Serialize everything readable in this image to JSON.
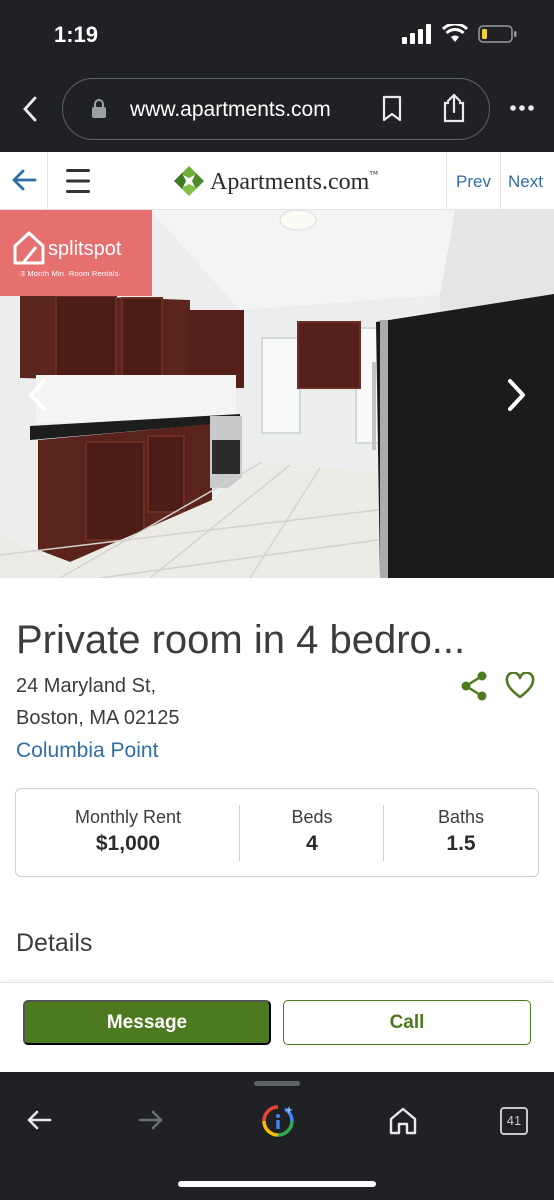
{
  "status_bar": {
    "time": "1:19"
  },
  "browser": {
    "url": "www.apartments.com",
    "tab_count": "41"
  },
  "site": {
    "logo": "Apartments.com",
    "logo_tm": "™",
    "prev": "Prev",
    "next": "Next"
  },
  "photo_badge": {
    "brand": "splitspot",
    "tagline": "·3 Month Min. Room Rentals·"
  },
  "listing": {
    "title": "Private room in 4 bedro...",
    "address_line1": "24 Maryland St,",
    "address_line2": "Boston, MA 02125",
    "neighborhood": "Columbia Point",
    "stats": [
      {
        "label": "Monthly Rent",
        "value": "$1,000"
      },
      {
        "label": "Beds",
        "value": "4"
      },
      {
        "label": "Baths",
        "value": "1.5"
      }
    ],
    "section_heading": "Details"
  },
  "actions": {
    "message": "Message",
    "call": "Call"
  },
  "colors": {
    "brand_green": "#4e7a1f",
    "link_blue": "#2f6ea5",
    "badge_coral": "#e66f6f",
    "chrome_dark": "#202124"
  }
}
